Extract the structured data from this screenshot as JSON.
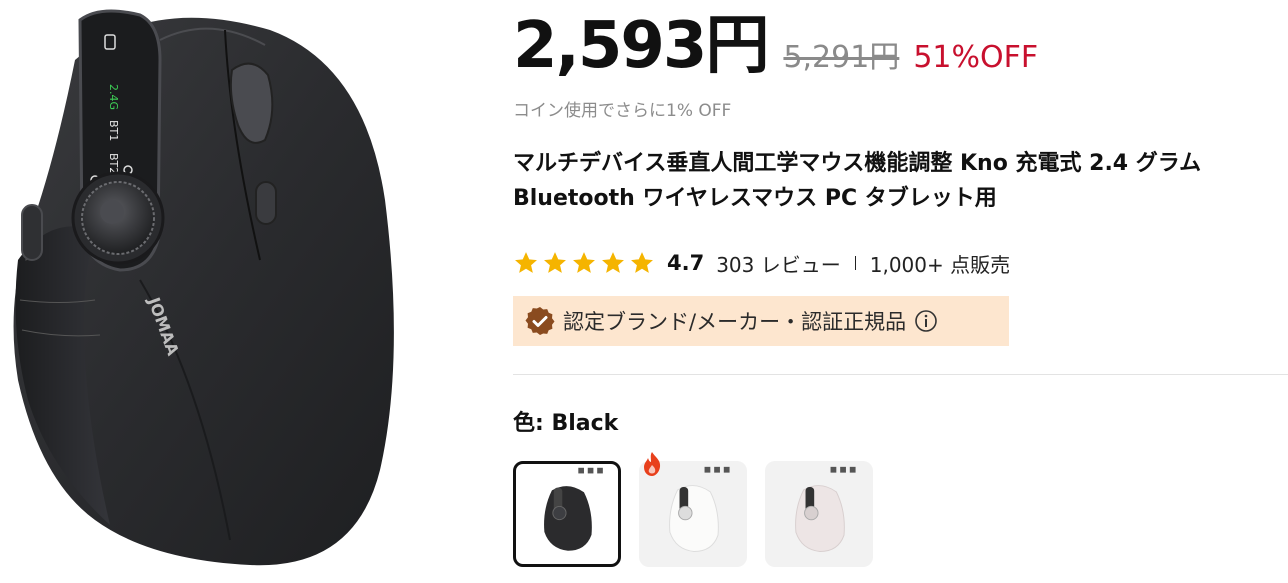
{
  "product": {
    "price": "2,593円",
    "original_price": "5,291円",
    "discount": "51%OFF",
    "coin_note": "コイン使用でさらに1% OFF",
    "title": "マルチデバイス垂直人間工学マウス機能調整 Kno 充電式 2.4 グラム Bluetooth ワイヤレスマウス PC タブレット用",
    "rating": "4.7",
    "stars": 5,
    "reviews": "303 レビュー",
    "sold": "1,000+ 点販売",
    "badge_text": "認定ブランド/メーカー・認証正規品",
    "color_label": "色: Black",
    "image_brand_text": "JOMAA",
    "image_panel_labels": [
      "2.4G",
      "BT1",
      "BT2"
    ]
  },
  "colors": {
    "discount": "#c8102e",
    "badge_bg": "#fde6cf",
    "badge_icon": "#8a4b1f",
    "star": "#f5b400",
    "hot_icon": "#e8401c"
  },
  "swatches": [
    {
      "name": "Black",
      "selected": true,
      "mouse_color": "#2b2b2d",
      "hot": false
    },
    {
      "name": "White",
      "selected": false,
      "mouse_color": "#f0f0ee",
      "hot": true
    },
    {
      "name": "Pink",
      "selected": false,
      "mouse_color": "#e9e1e1",
      "hot": false
    }
  ]
}
